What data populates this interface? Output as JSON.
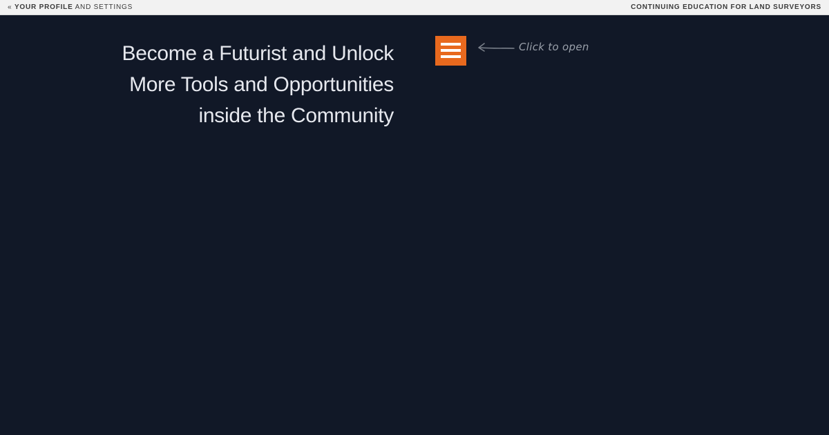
{
  "topbar": {
    "left_prefix": "« ",
    "left_strong": "YOUR PROFILE",
    "left_rest": " AND SETTINGS",
    "right_label": "CONTINUING EDUCATION FOR LAND SURVEYORS"
  },
  "hero": {
    "line1": "Become a Futurist and Unlock",
    "line2": "More Tools and Opportunities",
    "line3": "inside the Community"
  },
  "menu": {
    "icon": "hamburger-menu-icon",
    "hint_icon": "left-arrow-icon",
    "hint_text": "Click to open"
  },
  "colors": {
    "background": "#111827",
    "topbar": "#f2f2f2",
    "accent": "#e8691e",
    "heading_text": "#e6e8ee",
    "hint_text": "#9aa0aa"
  }
}
